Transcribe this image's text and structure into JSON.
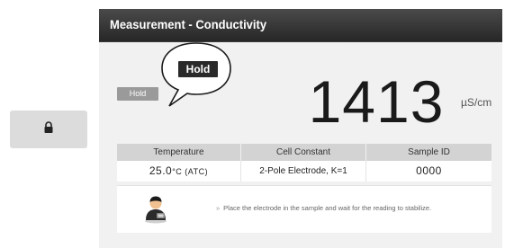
{
  "sidebar": {
    "lock_button_icon": "lock-icon"
  },
  "window": {
    "title": "Measurement - Conductivity"
  },
  "status": {
    "hold_badge": "Hold",
    "bubble_label": "Hold"
  },
  "measurement": {
    "value": "1413",
    "unit": "µS/cm"
  },
  "info_table": {
    "headers": [
      "Temperature",
      "Cell Constant",
      "Sample ID"
    ],
    "temperature_value": "25.0",
    "temperature_unit": "°C (ATC)",
    "cell_constant": "2-Pole Electrode, K=1",
    "sample_id": "0000"
  },
  "instruction": {
    "icon": "operator-icon",
    "bullet": "»",
    "text": "Place the electrode in the sample and wait for the reading to stabilize."
  },
  "colors": {
    "titlebar": "#333333",
    "panel_bg": "#f1f1f1",
    "header_cell": "#d3d3d3",
    "badge": "#9a9a9a",
    "bubble_label": "#2a2a2a"
  }
}
